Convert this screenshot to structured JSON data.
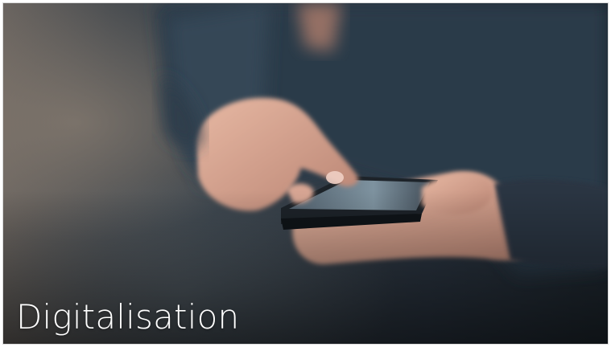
{
  "card": {
    "title": "Digitalisation",
    "image_icon": "photo-person-using-smartphone"
  },
  "colors": {
    "title_text": "#ffffff",
    "photo_background": "#26303a"
  }
}
